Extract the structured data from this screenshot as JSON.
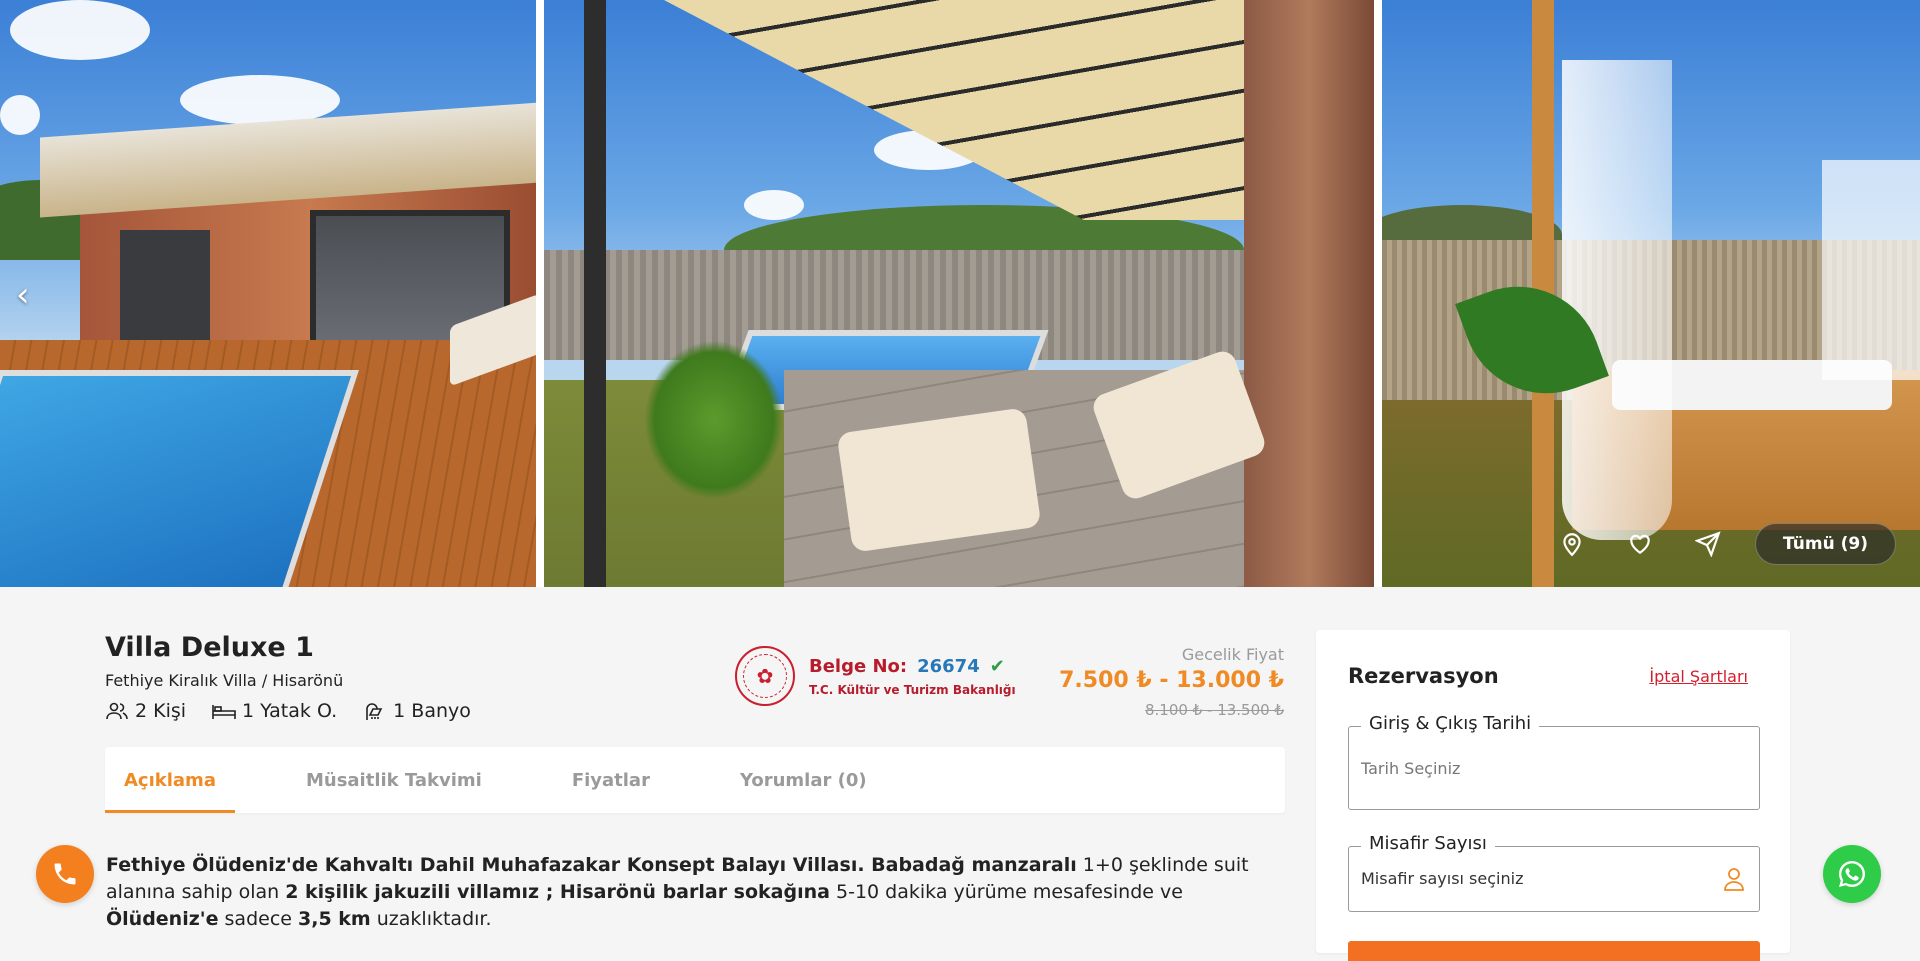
{
  "gallery": {
    "prev_arrow": "‹",
    "all_button": "Tümü (9)",
    "icons": [
      "location-pin-icon",
      "heart-icon",
      "share-icon"
    ]
  },
  "villa": {
    "title": "Villa Deluxe 1",
    "location": "Fethiye Kiralık Villa / Hisarönü",
    "features": {
      "guests": "2 Kişi",
      "beds": "1 Yatak O.",
      "baths": "1 Banyo"
    }
  },
  "license": {
    "label": "Belge No:",
    "number": "26674",
    "ministry": "T.C. Kültür ve Turizm Bakanlığı"
  },
  "price": {
    "label": "Gecelik Fiyat",
    "current": "7.500 ₺  -  13.000 ₺",
    "old": "8.100 ₺  -  13.500 ₺"
  },
  "tabs": [
    {
      "label": "Açıklama",
      "active": true
    },
    {
      "label": "Müsaitlik Takvimi",
      "active": false
    },
    {
      "label": "Fiyatlar",
      "active": false
    },
    {
      "label": "Yorumlar (0)",
      "active": false
    }
  ],
  "description": {
    "p1_b1": "Fethiye Ölüdeniz'de Kahvaltı Dahil Muhafazakar Konsept Balayı Villası. Babadağ manzaralı",
    "p1_t1": " 1+0 şeklinde suit alanına sahip olan ",
    "p1_b2": "2 kişilik jakuzili villamız ; Hisarönü barlar sokağına",
    "p1_t2": " 5-10 dakika yürüme mesafesinde ve ",
    "p1_b3": "Ölüdeniz'e",
    "p1_t3": " sadece ",
    "p1_b4": "3,5 km",
    "p1_t4": " uzaklıktadır."
  },
  "reservation": {
    "title": "Rezervasyon",
    "cancel_link": "İptal Şartları",
    "dates_label": "Giriş & Çıkış Tarihi",
    "dates_placeholder": "Tarih Seçiniz",
    "guests_label": "Misafir Sayısı",
    "guests_value": "Misafir sayısı seçiniz"
  },
  "colors": {
    "accent": "#f08a24",
    "whatsapp": "#2ecc48",
    "ministry_red": "#b71c2c",
    "license_blue": "#2877b7"
  }
}
